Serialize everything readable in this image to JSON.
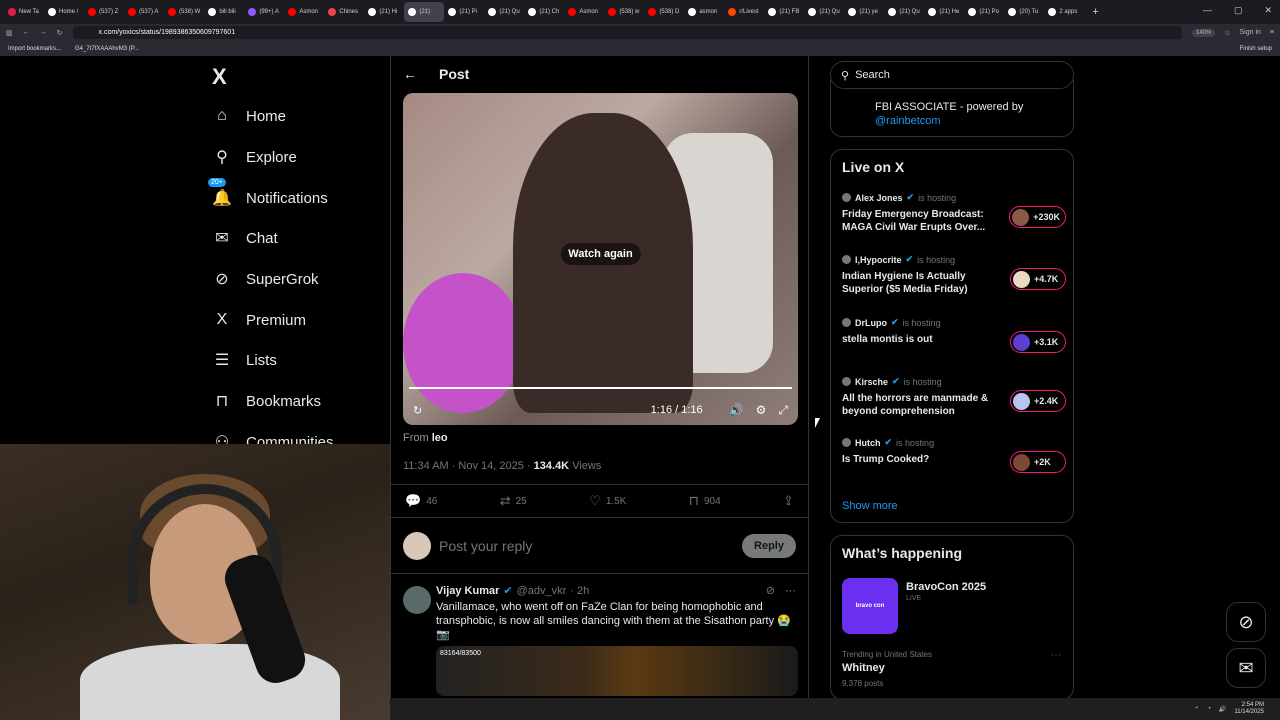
{
  "browser": {
    "tabs": [
      {
        "label": "New Ta",
        "color": "#e11d48",
        "active": false
      },
      {
        "label": "Home /",
        "color": "#ffffff",
        "active": false
      },
      {
        "label": "(537) Z",
        "color": "#ff0000",
        "active": false
      },
      {
        "label": "(537) A",
        "color": "#ff0000",
        "active": false
      },
      {
        "label": "(538) W",
        "color": "#ff0000",
        "active": false
      },
      {
        "label": "bili bili",
        "color": "#ffffff",
        "active": false
      },
      {
        "label": "(99+) A",
        "color": "#8b5cf6",
        "active": false
      },
      {
        "label": "Asmon",
        "color": "#ff0000",
        "active": false
      },
      {
        "label": "Chines",
        "color": "#ef4444",
        "active": false
      },
      {
        "label": "(21) Hi",
        "color": "#ffffff",
        "active": false
      },
      {
        "label": "(21)",
        "color": "#ffffff",
        "active": true
      },
      {
        "label": "(21) Pi",
        "color": "#ffffff",
        "active": false
      },
      {
        "label": "(21) Qu",
        "color": "#ffffff",
        "active": false
      },
      {
        "label": "(21) Ch",
        "color": "#ffffff",
        "active": false
      },
      {
        "label": "Asmon",
        "color": "#ff0000",
        "active": false
      },
      {
        "label": "(538) w",
        "color": "#ff0000",
        "active": false
      },
      {
        "label": "(538) D",
        "color": "#ff0000",
        "active": false
      },
      {
        "label": "asmon",
        "color": "#ffffff",
        "active": false
      },
      {
        "label": "r/Livest",
        "color": "#ff4500",
        "active": false
      },
      {
        "label": "(21) FB",
        "color": "#ffffff",
        "active": false
      },
      {
        "label": "(21) Qu",
        "color": "#ffffff",
        "active": false
      },
      {
        "label": "(21) ye",
        "color": "#ffffff",
        "active": false
      },
      {
        "label": "(21) Qu",
        "color": "#ffffff",
        "active": false
      },
      {
        "label": "(21) He",
        "color": "#ffffff",
        "active": false
      },
      {
        "label": "(21) Po",
        "color": "#ffffff",
        "active": false
      },
      {
        "label": "(20) Tu",
        "color": "#ffffff",
        "active": false
      },
      {
        "label": "2 apps",
        "color": "#ffffff",
        "active": false
      }
    ],
    "url": "x.com/yoxics/status/1989386350609797601",
    "zoom": "140%",
    "sign_in": "Sign in",
    "bookmarks": [
      "Import bookmarks...",
      "G4_7t7fXAAAhvM3 (P..."
    ],
    "finish_setup": "Finish setup"
  },
  "nav": {
    "logo": "X",
    "items": [
      {
        "label": "Home",
        "icon": "home-icon",
        "glyph": "⌂"
      },
      {
        "label": "Explore",
        "icon": "search-icon",
        "glyph": "⚲"
      },
      {
        "label": "Notifications",
        "icon": "bell-icon",
        "glyph": "🔔",
        "badge": "20+"
      },
      {
        "label": "Chat",
        "icon": "mail-icon",
        "glyph": "✉"
      },
      {
        "label": "SuperGrok",
        "icon": "grok-icon",
        "glyph": "⊘"
      },
      {
        "label": "Premium",
        "icon": "x-icon",
        "glyph": "X"
      },
      {
        "label": "Lists",
        "icon": "list-icon",
        "glyph": "☰"
      },
      {
        "label": "Bookmarks",
        "icon": "bookmark-icon",
        "glyph": "⊓"
      },
      {
        "label": "Communities",
        "icon": "communities-icon",
        "glyph": "⚇"
      }
    ]
  },
  "post": {
    "header_title": "Post",
    "video": {
      "overlay": "Watch again",
      "time": "1:16 / 1:16",
      "progress": 1.0
    },
    "from_prefix": "From",
    "from_user": "leo",
    "timestamp": "11:34 AM · Nov 14, 2025 · ",
    "views_count": "134.4K",
    "views_label": " Views",
    "actions": {
      "replies": "46",
      "reposts": "25",
      "likes": "1.5K",
      "bookmarks": "904"
    },
    "reply_placeholder": "Post your reply",
    "reply_button": "Reply"
  },
  "reply_tweet": {
    "name": "Vijay Kumar",
    "handle": "@adv_vkr",
    "time": "· 2h",
    "text": "Vanillamace, who went off on FaZe Clan for being homophobic and transphobic, is now all smiles dancing with them at the Sisathon party 😭 📷",
    "media_label": "83164/83500"
  },
  "sidebar": {
    "search_placeholder": "Search",
    "top_card": {
      "line1": "FBI ASSOCIATE - powered by",
      "link": "@rainbetcom"
    },
    "live": {
      "title": "Live on X",
      "hosting_label": "is hosting",
      "items": [
        {
          "host": "Alex Jones",
          "title": "Friday Emergency Broadcast: MAGA Civil War Erupts Over...",
          "count": "+230K",
          "avatar_color": "#8a5a44"
        },
        {
          "host": "I,Hypocrite",
          "title": "Indian Hygiene Is Actually Superior ($5 Media Friday)",
          "count": "+4.7K",
          "avatar_color": "#e8d9c0"
        },
        {
          "host": "DrLupo",
          "title": "stella montis is out",
          "count": "+3.1K",
          "avatar_color": "#5b3fd0"
        },
        {
          "host": "Kirsche",
          "title": "All the horrors are manmade & beyond comprehension",
          "count": "+2.4K",
          "avatar_color": "#b8c4f0"
        },
        {
          "host": "Hutch",
          "title": "Is Trump Cooked?",
          "count": "+2K",
          "avatar_color": "#7a4a34"
        }
      ],
      "show_more": "Show more"
    },
    "happening": {
      "title": "What’s happening",
      "event_thumb": "bravo con",
      "event_name": "BravoCon 2025",
      "event_status": "LIVE",
      "trend_context": "Trending in United States",
      "trend_name": "Whitney",
      "trend_posts": "9,378 posts"
    }
  },
  "taskbar": {
    "time": "2:54 PM",
    "date": "11/14/2025"
  }
}
